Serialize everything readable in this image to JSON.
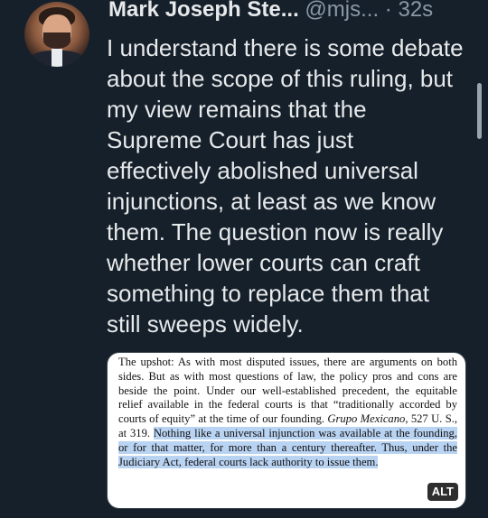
{
  "tweet": {
    "author_name": "Mark Joseph Ste...",
    "handle": "@mjs...",
    "separator": "·",
    "timestamp": "32s",
    "text": "I understand there is some debate about the scope of this ruling, but my view remains that the Supreme Court has just effectively abolished universal injunctions, at least as we know them. The question now is really whether lower courts can craft something to replace them that still sweeps widely."
  },
  "image": {
    "excerpt_before_case": "The upshot: As with most disputed issues, there are arguments on both sides. But as with most questions of law, the policy pros and cons are beside the point. Under our well-established precedent, the equitable relief available in the federal courts is that “traditionally accorded by courts of equity” at the time of our founding.",
    "case_name": "Grupo Mexicano",
    "citation": ", 527 U. S., at 319.",
    "highlighted": "Nothing like a universal injunction was available at the founding, or for that matter, for more than a century thereafter. Thus, under the Judiciary Act, federal courts lack authority to issue them.",
    "alt_label": "ALT"
  }
}
